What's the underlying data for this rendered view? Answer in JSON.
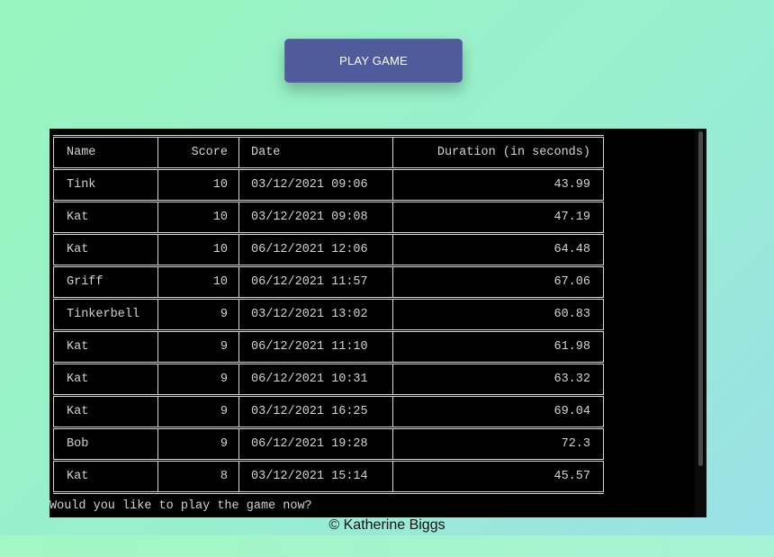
{
  "play_button": {
    "label": "PLAY GAME"
  },
  "table": {
    "headers": {
      "name": "Name",
      "score": "Score",
      "date": "Date",
      "duration": "Duration (in seconds)"
    },
    "rows": [
      {
        "name": "Tink",
        "score": "10",
        "date": "03/12/2021 09:06",
        "duration": "43.99"
      },
      {
        "name": "Kat",
        "score": "10",
        "date": "03/12/2021 09:08",
        "duration": "47.19"
      },
      {
        "name": "Kat",
        "score": "10",
        "date": "06/12/2021 12:06",
        "duration": "64.48"
      },
      {
        "name": "Griff",
        "score": "10",
        "date": "06/12/2021 11:57",
        "duration": "67.06"
      },
      {
        "name": "Tinkerbell",
        "score": "9",
        "date": "03/12/2021 13:02",
        "duration": "60.83"
      },
      {
        "name": "Kat",
        "score": "9",
        "date": "06/12/2021 11:10",
        "duration": "61.98"
      },
      {
        "name": "Kat",
        "score": "9",
        "date": "06/12/2021 10:31",
        "duration": "63.32"
      },
      {
        "name": "Kat",
        "score": "9",
        "date": "03/12/2021 16:25",
        "duration": "69.04"
      },
      {
        "name": "Bob",
        "score": "9",
        "date": "06/12/2021 19:28",
        "duration": "72.3"
      },
      {
        "name": "Kat",
        "score": "8",
        "date": "03/12/2021 15:14",
        "duration": "45.57"
      }
    ]
  },
  "prompt": "Would you like to play the game now?",
  "footer": "© Katherine Biggs",
  "colors": {
    "button": "#4f5b9a",
    "terminal_bg": "#000000",
    "terminal_text": "#d2d2d2"
  }
}
